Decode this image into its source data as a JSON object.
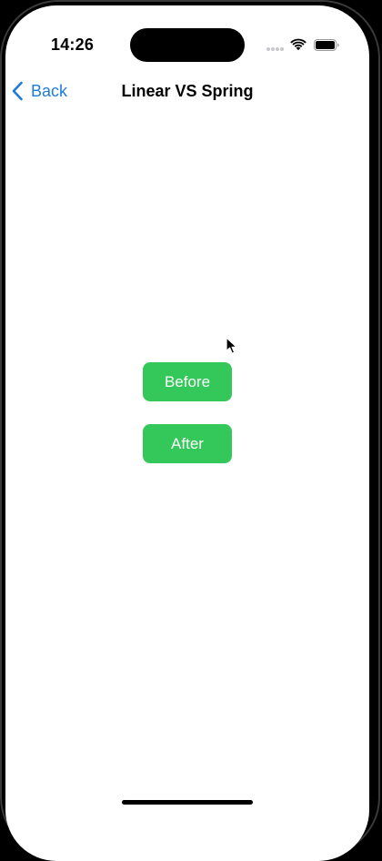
{
  "status_bar": {
    "time": "14:26",
    "icons": [
      "cellular-signal-icon",
      "wifi-icon",
      "battery-icon"
    ]
  },
  "nav": {
    "back_label": "Back",
    "title": "Linear VS Spring",
    "back_icon": "chevron-left-icon"
  },
  "main": {
    "buttons": [
      {
        "label": "Before"
      },
      {
        "label": "After"
      }
    ]
  },
  "colors": {
    "accent": "#1e7bd8",
    "button_green": "#34c759",
    "background": "#ffffff",
    "frame": "#000000"
  }
}
